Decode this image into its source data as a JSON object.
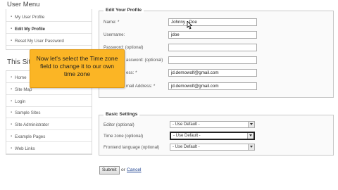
{
  "sidebar": {
    "user_menu_title": "User Menu",
    "user_menu_items": [
      {
        "label": "My User Profile"
      },
      {
        "label": "Edit My Profile"
      },
      {
        "label": "Reset My User Password"
      }
    ],
    "site_title": "This Sit",
    "site_items": [
      {
        "label": "Home"
      },
      {
        "label": "Site Map"
      },
      {
        "label": "Login"
      },
      {
        "label": "Sample Sites"
      },
      {
        "label": "Site Administrator"
      },
      {
        "label": "Example Pages"
      },
      {
        "label": "Web Links"
      }
    ]
  },
  "edit_profile": {
    "legend": "Edit Your Profile",
    "fields": [
      {
        "label": "Name: *",
        "value": "Johnny · Doe"
      },
      {
        "label": "Username:",
        "value": "jdoe"
      },
      {
        "label": "Password: (optional)",
        "value": ""
      },
      {
        "label": "assword: (optional)",
        "value": ""
      },
      {
        "label": "ess: *",
        "value": "jd.demowolf@gmail.com"
      },
      {
        "label": "mail Address: *",
        "value": "jd.demowolf@gmail.com"
      }
    ]
  },
  "basic_settings": {
    "legend": "Basic Settings",
    "fields": [
      {
        "label": "Editor (optional)",
        "value": "- Use Default -"
      },
      {
        "label": "Time zone (optional)",
        "value": "- Use Default -"
      },
      {
        "label": "Frontend language (optional)",
        "value": "- Use Default -"
      }
    ]
  },
  "actions": {
    "submit_label": "Submit",
    "or_text": "or",
    "cancel_label": "Cancel"
  },
  "callout": {
    "text": "Now let's select the Time zone field to change it to our own time zone"
  },
  "colors": {
    "callout_bg": "#fbb525",
    "link": "#1a3f8f"
  }
}
